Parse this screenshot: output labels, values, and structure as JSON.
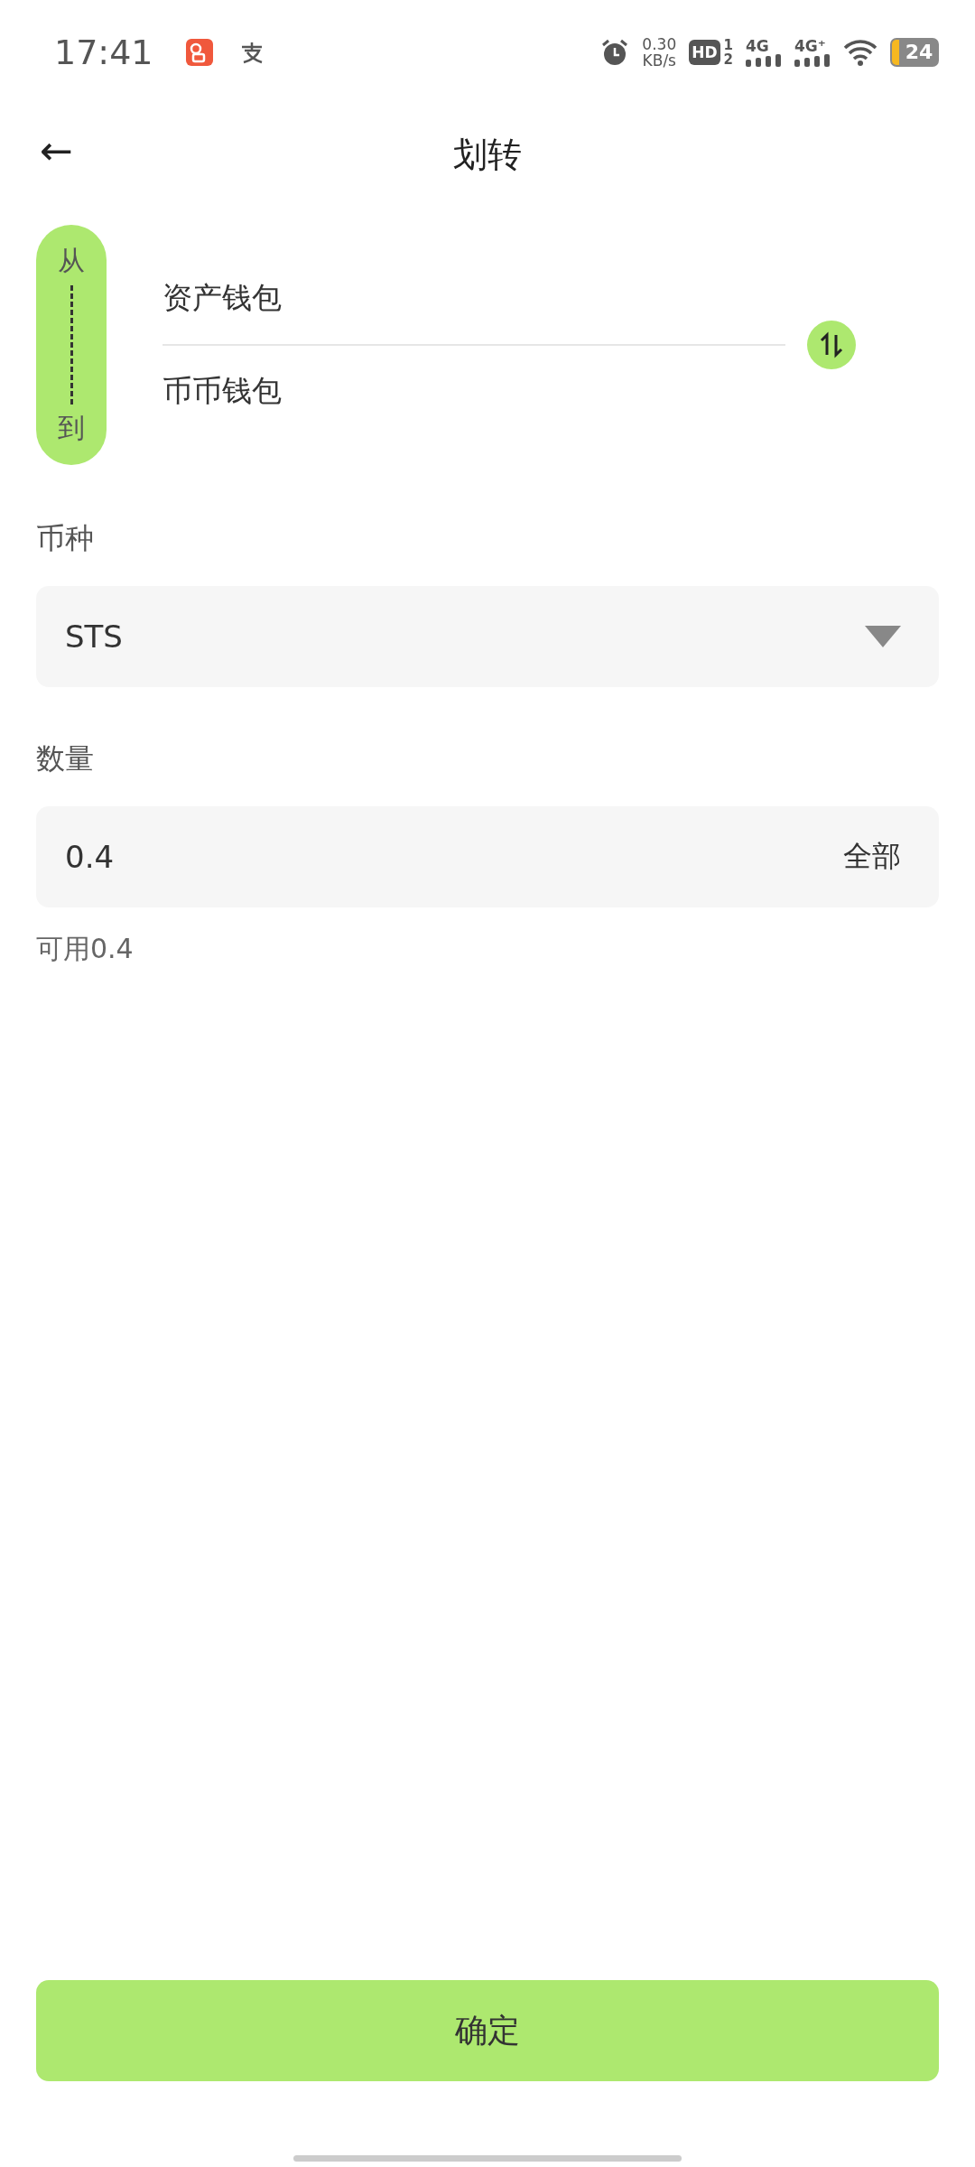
{
  "status_bar": {
    "time": "17:41",
    "speed_value": "0.30",
    "speed_unit": "KB/s",
    "hd_label": "HD",
    "hd_sup": "1",
    "hd_sub": "2",
    "network_1": "4G",
    "network_2": "4G⁺",
    "battery": "24"
  },
  "header": {
    "back_icon": "←",
    "title": "划转"
  },
  "transfer": {
    "from_label": "从",
    "to_label": "到",
    "from_wallet": "资产钱包",
    "to_wallet": "币币钱包"
  },
  "currency": {
    "label": "币种",
    "value": "STS"
  },
  "amount": {
    "label": "数量",
    "value": "0.4",
    "all_button": "全部"
  },
  "available": "可用0.4",
  "confirm_button": "确定"
}
